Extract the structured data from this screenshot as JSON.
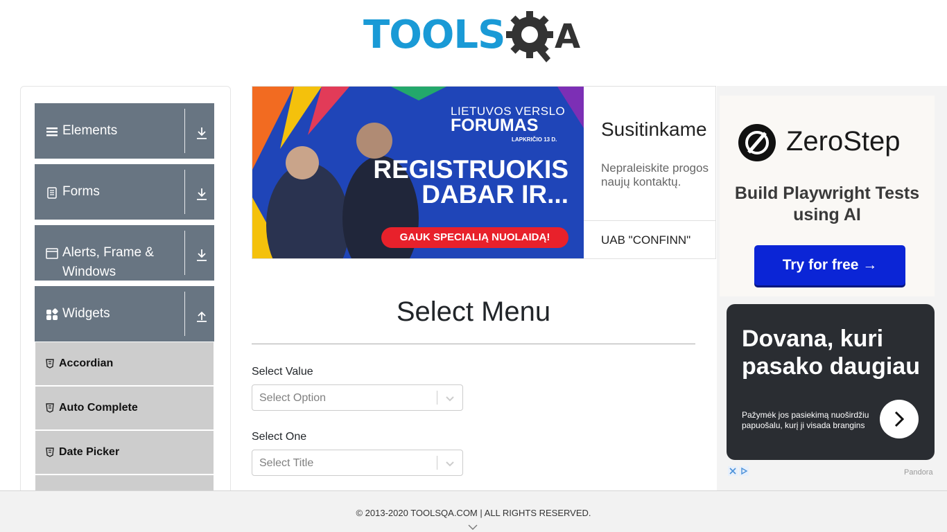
{
  "header": {
    "logo_text": "TOOLSQA"
  },
  "sidebar": {
    "groups": [
      {
        "label": "Elements",
        "icon": "hamburger-icon",
        "expanded": false
      },
      {
        "label": "Forms",
        "icon": "document-icon",
        "expanded": false
      },
      {
        "label": "Alerts, Frame & Windows",
        "icon": "window-icon",
        "expanded": false
      },
      {
        "label": "Widgets",
        "icon": "widgets-icon",
        "expanded": true
      }
    ],
    "items": [
      {
        "label": "Accordian",
        "icon": "html5-shield-icon"
      },
      {
        "label": "Auto Complete",
        "icon": "html5-shield-icon"
      },
      {
        "label": "Date Picker",
        "icon": "html5-shield-icon"
      }
    ]
  },
  "ad_banner": {
    "forum_line1": "LIETUVOS VERSLO",
    "forum_line2": "FORUMAS",
    "date": "LAPKRIČIO 13 D.",
    "headline_line1": "REGISTRUOKIS",
    "headline_line2": "DABAR IR...",
    "cta": "GAUK SPECIALIĄ NUOLAIDĄ!",
    "title": "Susitinkame",
    "description": "Nepraleiskite progos naujų kontaktų.",
    "company": "UAB \"CONFINN\""
  },
  "main": {
    "title": "Select Menu",
    "fields": [
      {
        "label": "Select Value",
        "placeholder": "Select Option"
      },
      {
        "label": "Select One",
        "placeholder": "Select Title"
      }
    ]
  },
  "right_ad": {
    "brand": "ZeroStep",
    "tagline": "Build Playwright Tests using AI",
    "button": "Try for free →",
    "card_title": "Dovana, kuri pasako daugiau",
    "card_sub": "Pažymėk jos pasiekimą nuoširdžiu papuošalu, kurį ji visada brangins",
    "sponsor": "Pandora"
  },
  "footer": {
    "text": "© 2013-2020 TOOLSQA.COM | ALL RIGHTS RESERVED."
  },
  "colors": {
    "sidebar_group_bg": "#687582",
    "sidebar_item_bg": "#cdcdcd",
    "logo_blue": "#1a9ad6",
    "logo_dark": "#333333",
    "zerostep_button": "#0b25d6",
    "pandora_card": "#2a2d32"
  }
}
